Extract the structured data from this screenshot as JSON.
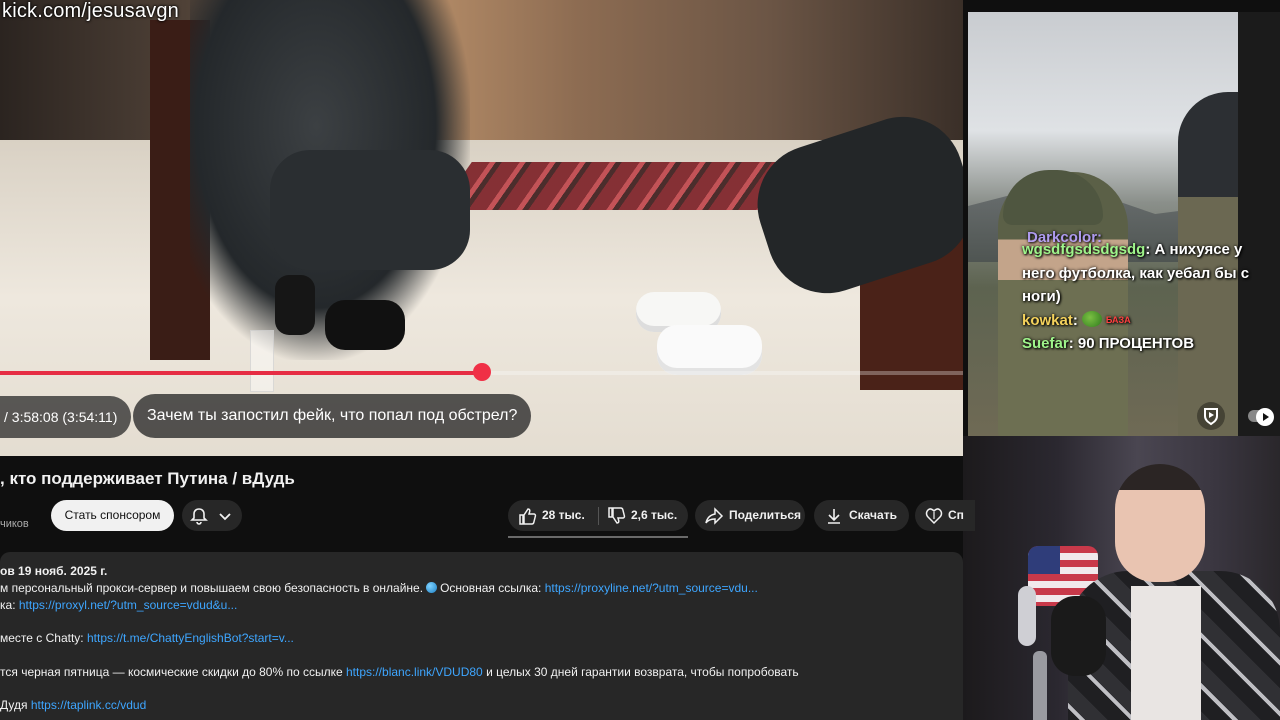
{
  "overlay": {
    "url": "kick.com/jesusavgn"
  },
  "player": {
    "time_text": "/ 3:58:08 (3:54:11)",
    "chapter_text": "Зачем ты запостил фейк, что попал под обстрел?",
    "progress_fraction": 0.5,
    "progress_color": "#e62d44"
  },
  "stream_chat": {
    "partial_top": "Darkcolor:",
    "messages": [
      {
        "user": "wgsdfgsdsdgsdg",
        "text": ": А нихуясе у него футболка, как уебал бы с ноги)"
      },
      {
        "user": "kowkat",
        "text": ":",
        "emote": "peepo-icon",
        "emote_tag": "БАЗА"
      },
      {
        "user": "Suefar",
        "text": ": 90 ПРОЦЕНТОВ"
      }
    ]
  },
  "video": {
    "title": ", кто поддерживает Путина / вДудь",
    "subscribers": "чиков",
    "sponsor_label": "Стать спонсором",
    "likes": "28 тыс.",
    "dislikes": "2,6 тыс.",
    "share_label": "Поделиться",
    "download_label": "Скачать",
    "spons_short": "Сп"
  },
  "description": {
    "meta": "ов  19 нояб. 2025 г.",
    "line1_text": "м персональный прокси-сервер и повышаем свою безопасность в онлайне.",
    "line1_label": "Основная ссылка:",
    "line1_link": "https://proxyline.net/?utm_source=vdu...",
    "line2_text": "ка:",
    "line2_link": "https://proxyl.net/?utm_source=vdud&u...",
    "line3_text": "месте с Chatty:",
    "line3_link": "https://t.me/ChattyEnglishBot?start=v...",
    "line4_text": "тся черная пятница — космические скидки до 80% по ссылке",
    "line4_link": "https://blanc.link/VDUD80",
    "line4_tail": "и целых 30 дней гарантии возврата, чтобы попробовать",
    "line5_text": "Дудя",
    "line5_link": "https://taplink.cc/vdud"
  }
}
